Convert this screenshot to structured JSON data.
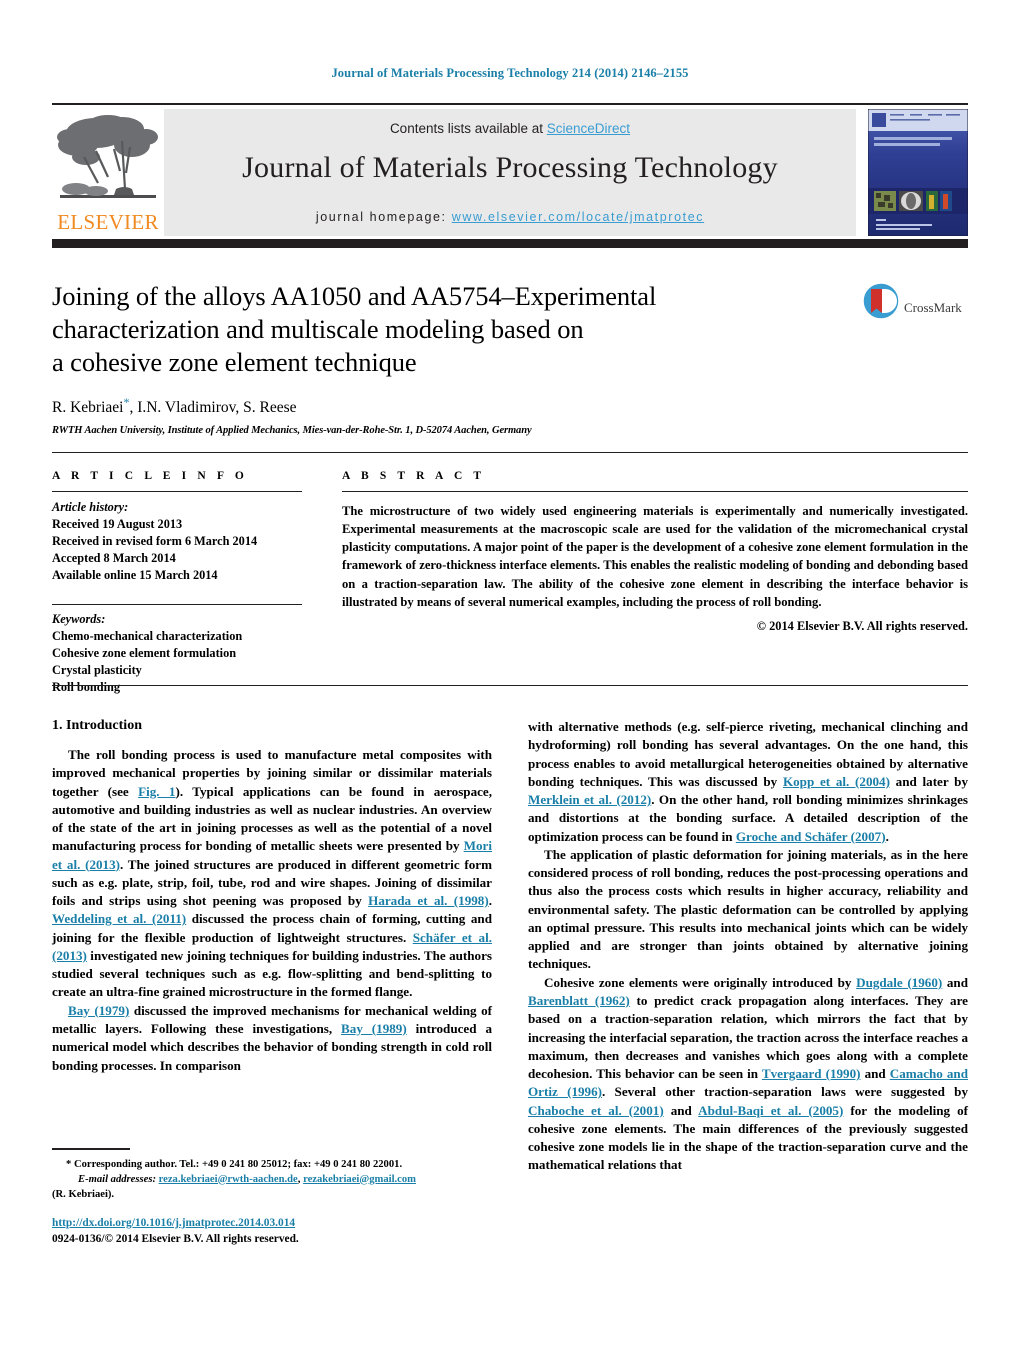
{
  "running_head": "Journal of Materials Processing Technology 214 (2014) 2146–2155",
  "masthead": {
    "contents_prefix": "Contents lists available at ",
    "sciencedirect": "ScienceDirect",
    "journal_title": "Journal of Materials Processing Technology",
    "homepage_prefix": "journal homepage: ",
    "homepage_url": "www.elsevier.com/locate/jmatprotec",
    "publisher": "ELSEVIER",
    "cover_title_line1": "JOURNAL OF MATERIALS",
    "cover_title_line2": "PROCESSING TECHNOLOGY"
  },
  "crossmark": {
    "label": "CrossMark"
  },
  "article": {
    "title_line1": "Joining of the alloys AA1050 and AA5754–Experimental",
    "title_line2": "characterization and multiscale modeling based on",
    "title_line3": "a cohesive zone element technique",
    "authors": "R. Kebriaei",
    "authors_rest": ", I.N. Vladimirov, S. Reese",
    "corresponding_marker": "*",
    "affiliation": "RWTH Aachen University, Institute of Applied Mechanics, Mies-van-der-Rohe-Str. 1, D-52074 Aachen, Germany"
  },
  "article_info": {
    "heading": "A R T I C L E  I N F O",
    "history_heading": "Article history:",
    "history": [
      "Received 19 August 2013",
      "Received in revised form 6 March 2014",
      "Accepted 8 March 2014",
      "Available online 15 March 2014"
    ],
    "keywords_heading": "Keywords:",
    "keywords": [
      "Chemo-mechanical characterization",
      "Cohesive zone element formulation",
      "Crystal plasticity",
      "Roll bonding"
    ]
  },
  "abstract": {
    "heading": "A B S T R A C T",
    "text": "The microstructure of two widely used engineering materials is experimentally and numerically investigated. Experimental measurements at the macroscopic scale are used for the validation of the micromechanical crystal plasticity computations. A major point of the paper is the development of a cohesive zone element formulation in the framework of zero-thickness interface elements. This enables the realistic modeling of bonding and debonding based on a traction-separation law. The ability of the cohesive zone element in describing the interface behavior is illustrated by means of several numerical examples, including the process of roll bonding.",
    "copyright": "© 2014 Elsevier B.V. All rights reserved."
  },
  "body": {
    "section_number": "1.",
    "section_title": "Introduction",
    "left_p1_a": "The roll bonding process is used to manufacture metal composites with improved mechanical properties by joining similar or dissimilar materials together (see ",
    "left_p1_fig": "Fig. 1",
    "left_p1_b": "). Typical applications can be found in aerospace, automotive and building industries as well as nuclear industries. An overview of the state of the art in joining processes as well as the potential of a novel manufacturing process for bonding of metallic sheets were presented by ",
    "left_p1_ref1": "Mori et al. (2013)",
    "left_p1_c": ". The joined structures are produced in different geometric form such as e.g. plate, strip, foil, tube, rod and wire shapes. Joining of dissimilar foils and strips using shot peening was proposed by ",
    "left_p1_ref2": "Harada et al. (1998)",
    "left_p1_d": ". ",
    "left_p1_ref3": "Weddeling et al. (2011)",
    "left_p1_e": " discussed the process chain of forming, cutting and joining for the flexible production of lightweight structures. ",
    "left_p1_ref4": "Schäfer et al. (2013)",
    "left_p1_f": " investigated new joining techniques for building industries. The authors studied several techniques such as e.g. flow-splitting and bend-splitting to create an ultra-fine grained microstructure in the formed flange.",
    "left_p2_ref1": "Bay (1979)",
    "left_p2_a": " discussed the improved mechanisms for mechanical welding of metallic layers. Following these investigations, ",
    "left_p2_ref2": "Bay (1989)",
    "left_p2_b": " introduced a numerical model which describes the behavior of bonding strength in cold roll bonding processes. In comparison",
    "right_p1_a": "with alternative methods (e.g. self-pierce riveting, mechanical clinching and hydroforming) roll bonding has several advantages. On the one hand, this process enables to avoid metallurgical heterogeneities obtained by alternative bonding techniques. This was discussed by ",
    "right_p1_ref1": "Kopp et al. (2004)",
    "right_p1_b": " and later by ",
    "right_p1_ref2": "Merklein et al. (2012)",
    "right_p1_c": ". On the other hand, roll bonding minimizes shrinkages and distortions at the bonding surface. A detailed description of the optimization process can be found in ",
    "right_p1_ref3": "Groche and Schäfer (2007)",
    "right_p1_d": ".",
    "right_p2": "The application of plastic deformation for joining materials, as in the here considered process of roll bonding, reduces the post-processing operations and thus also the process costs which results in higher accuracy, reliability and environmental safety. The plastic deformation can be controlled by applying an optimal pressure. This results into mechanical joints which can be widely applied and are stronger than joints obtained by alternative joining techniques.",
    "right_p3_a": "Cohesive zone elements were originally introduced by ",
    "right_p3_ref1": "Dugdale (1960)",
    "right_p3_b": " and ",
    "right_p3_ref2": "Barenblatt (1962)",
    "right_p3_c": " to predict crack propagation along interfaces. They are based on a traction-separation relation, which mirrors the fact that by increasing the interfacial separation, the traction across the interface reaches a maximum, then decreases and vanishes which goes along with a complete decohesion. This behavior can be seen in ",
    "right_p3_ref3": "Tvergaard (1990)",
    "right_p3_d": " and ",
    "right_p3_ref4": "Camacho and Ortiz (1996)",
    "right_p3_e": ". Several other traction-separation laws were suggested by ",
    "right_p3_ref5": "Chaboche et al. (2001)",
    "right_p3_f": " and ",
    "right_p3_ref6": "Abdul-Baqi et al. (2005)",
    "right_p3_g": " for the modeling of cohesive zone elements. The main differences of the previously suggested cohesive zone models lie in the shape of the traction-separation curve and the mathematical relations that"
  },
  "footnote": {
    "star": "*",
    "corresponding": " Corresponding author. Tel.: +49 0 241 80 25012; fax: +49 0 241 80 22001.",
    "email_label": "E-mail addresses:",
    "email1": "reza.kebriaei@rwth-aachen.de",
    "email_sep": ", ",
    "email2": "rezakebriaei@gmail.com",
    "email_owner": "(R. Kebriaei)."
  },
  "doi": {
    "url": "http://dx.doi.org/10.1016/j.jmatprotec.2014.03.014",
    "issn": "0924-0136/© 2014 Elsevier B.V. All rights reserved."
  },
  "colors": {
    "link_blue": "#1a7fa8",
    "sd_blue": "#3a9dd2",
    "elsevier_orange": "#f08a22",
    "rule_black": "#231f20",
    "band_gray": "#e9e9e9",
    "cover_blue": "#2b3f8f"
  }
}
